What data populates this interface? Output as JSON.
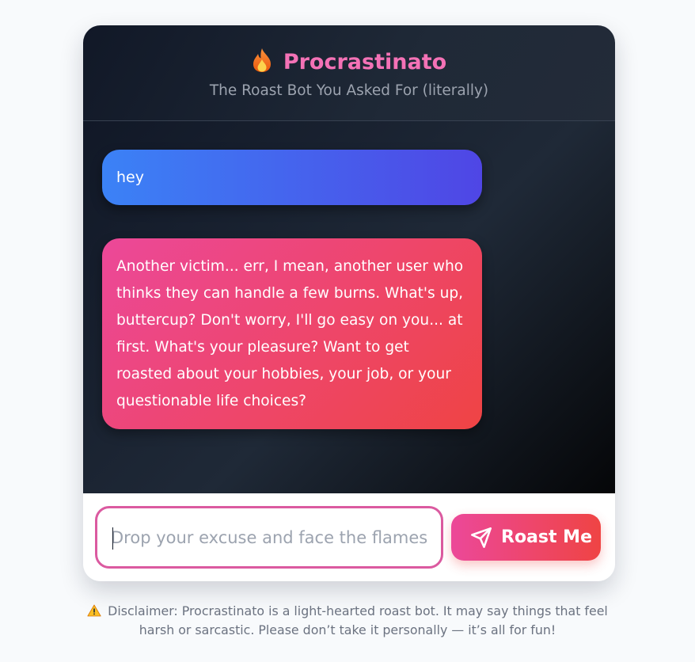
{
  "header": {
    "icon": "fire-icon",
    "title": "Procrastinato",
    "subtitle": "The Roast Bot You Asked For (literally)",
    "title_color": "#f472b6"
  },
  "messages": [
    {
      "role": "user",
      "text": "hey"
    },
    {
      "role": "bot",
      "text": "Another victim... err, I mean, another user who thinks they can handle a few burns. What's up, buttercup? Don't worry, I'll go easy on you... at first. What's your pleasure? Want to get roasted about your hobbies, your job, or your questionable life choices?"
    }
  ],
  "composer": {
    "placeholder": "Drop your excuse and face the flames",
    "value": "",
    "send_label": "Roast Me",
    "send_icon": "send-icon"
  },
  "disclaimer": {
    "icon": "warning-icon",
    "text": "Disclaimer: Procrastinato is a light-hearted roast bot. It may say things that feel harsh or sarcastic. Please don’t take it personally — it’s all for fun!"
  },
  "colors": {
    "accent": "#ec4899",
    "accent_end": "#ef4444",
    "user_bubble": "#3b82f6",
    "user_bubble_end": "#4f46e5",
    "chat_bg": "#111827"
  }
}
